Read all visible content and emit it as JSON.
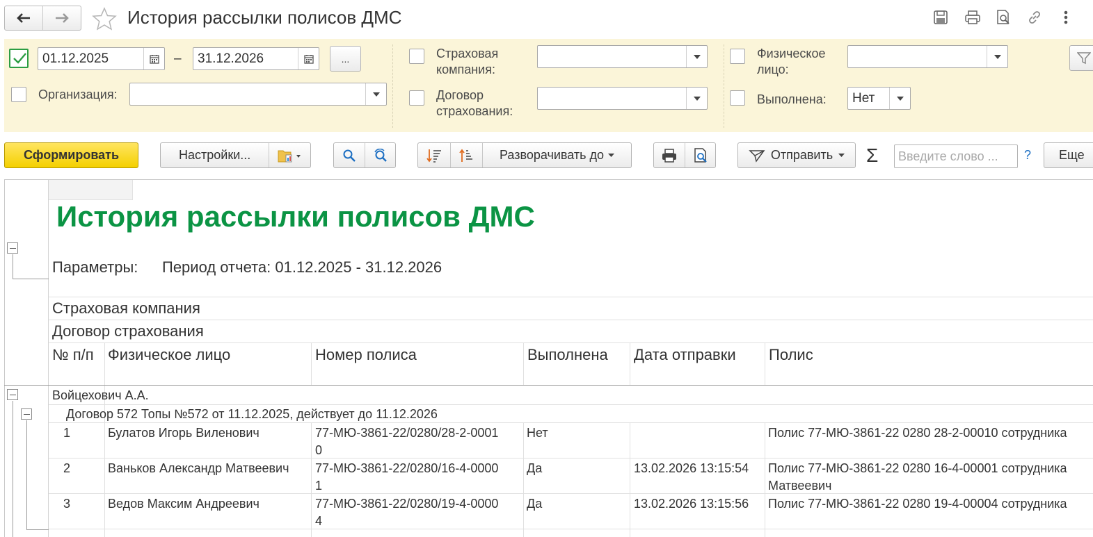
{
  "window": {
    "title": "История рассылки полисов ДМС"
  },
  "filters": {
    "period": {
      "checked": true,
      "from": "01.12.2025",
      "dash": "–",
      "to": "31.12.2026",
      "more_label": "..."
    },
    "organization": {
      "label": "Организация:",
      "value": ""
    },
    "insurance_company": {
      "label_line1": "Страховая",
      "label_line2": "компания:",
      "value": ""
    },
    "insurance_contract": {
      "label_line1": "Договор",
      "label_line2": "страхования:",
      "value": ""
    },
    "person": {
      "label_line1": "Физическое",
      "label_line2": "лицо:",
      "value": ""
    },
    "done": {
      "label": "Выполнена:",
      "value": "Нет"
    }
  },
  "toolbar": {
    "generate_label": "Сформировать",
    "settings_label": "Настройки...",
    "expand_label": "Разворачивать до",
    "send_label": "Отправить",
    "sigma": "Σ",
    "search_placeholder": "Введите слово ...",
    "help": "?",
    "more_label": "Еще"
  },
  "report": {
    "title": "История рассылки полисов ДМС",
    "params_label": "Параметры:",
    "params_value": "Период отчета: 01.12.2025 - 31.12.2026",
    "group1": "Страховая компания",
    "group2": "Договор страхования",
    "columns": [
      "№ п/п",
      "Физическое лицо",
      "Номер полиса",
      "Выполнена",
      "Дата отправки",
      "Полис"
    ],
    "group_company": "Войцехович А.А.",
    "group_contract": "Договор 572 Топы №572 от 11.12.2025, действует до 11.12.2026",
    "rows": [
      {
        "num": "1",
        "person": "Булатов Игорь Виленович",
        "policy_line1": "77-МЮ-3861-22/0280/28-2-0001",
        "policy_line2": "0",
        "done": "Нет",
        "date": "",
        "policy_text_line1": "Полис 77-МЮ-3861-22 0280 28-2-00010 сотрудника",
        "policy_text_line2": ""
      },
      {
        "num": "2",
        "person": "Ваньков Александр Матвеевич",
        "policy_line1": "77-МЮ-3861-22/0280/16-4-0000",
        "policy_line2": "1",
        "done": "Да",
        "date": "13.02.2026 13:15:54",
        "policy_text_line1": "Полис 77-МЮ-3861-22 0280 16-4-00001 сотрудника",
        "policy_text_line2": "Матвеевич"
      },
      {
        "num": "3",
        "person": "Ведов Максим Андреевич",
        "policy_line1": "77-МЮ-3861-22/0280/19-4-0000",
        "policy_line2": "4",
        "done": "Да",
        "date": "13.02.2026 13:15:56",
        "policy_text_line1": "Полис 77-МЮ-3861-22 0280 19-4-00004 сотрудника",
        "policy_text_line2": ""
      }
    ]
  }
}
